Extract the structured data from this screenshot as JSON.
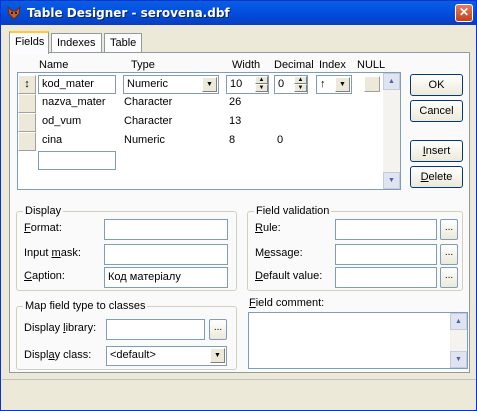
{
  "window": {
    "title": "Table Designer - serovena.dbf",
    "close_glyph": "✕"
  },
  "tabs": [
    {
      "label": "Fields",
      "active": true
    },
    {
      "label": "Indexes",
      "active": false
    },
    {
      "label": "Table",
      "active": false
    }
  ],
  "grid": {
    "headers": {
      "name": "Name",
      "type": "Type",
      "width": "Width",
      "decimal": "Decimal",
      "index": "Index",
      "null": "NULL"
    },
    "current_row": {
      "selector_glyph": "↕",
      "name": "kod_mater",
      "type": "Numeric",
      "width": "10",
      "decimal": "0",
      "index": "↑"
    },
    "rows": [
      {
        "name": "nazva_mater",
        "type": "Character",
        "width": "26",
        "decimal": ""
      },
      {
        "name": "od_vum",
        "type": "Character",
        "width": "13",
        "decimal": ""
      },
      {
        "name": "cina",
        "type": "Numeric",
        "width": "8",
        "decimal": "0"
      }
    ],
    "new_row_name": ""
  },
  "buttons": {
    "ok": "OK",
    "cancel": "Cancel",
    "insert_pre": "",
    "insert_u": "I",
    "insert_post": "nsert",
    "delete_pre": "",
    "delete_u": "D",
    "delete_post": "elete"
  },
  "display": {
    "title": "Display",
    "format_u": "F",
    "format_post": "ormat:",
    "input_mask_pre": "Input ",
    "input_mask_u": "m",
    "input_mask_post": "ask:",
    "caption_u": "C",
    "caption_post": "aption:",
    "format_value": "",
    "input_mask_value": "",
    "caption_value": "Код матеріалу"
  },
  "map": {
    "title": "Map field type to classes",
    "library_pre": "Display ",
    "library_u": "l",
    "library_post": "ibrary:",
    "class_pre": "Displ",
    "class_u": "a",
    "class_post": "y class:",
    "library_value": "",
    "class_value": "<default>",
    "browse": "..."
  },
  "validation": {
    "title": "Field validation",
    "rule_u": "R",
    "rule_post": "ule:",
    "message_pre": "M",
    "message_u": "e",
    "message_post": "ssage:",
    "default_u": "D",
    "default_post": "efault value:",
    "rule_value": "",
    "message_value": "",
    "default_value": "",
    "browse": "..."
  },
  "comment": {
    "label_u": "F",
    "label_post": "ield comment:",
    "value": ""
  },
  "colors": {
    "titlebar": "#0454e6",
    "window_bg": "#ece9d8",
    "tab_highlight": "#ffc83c"
  }
}
